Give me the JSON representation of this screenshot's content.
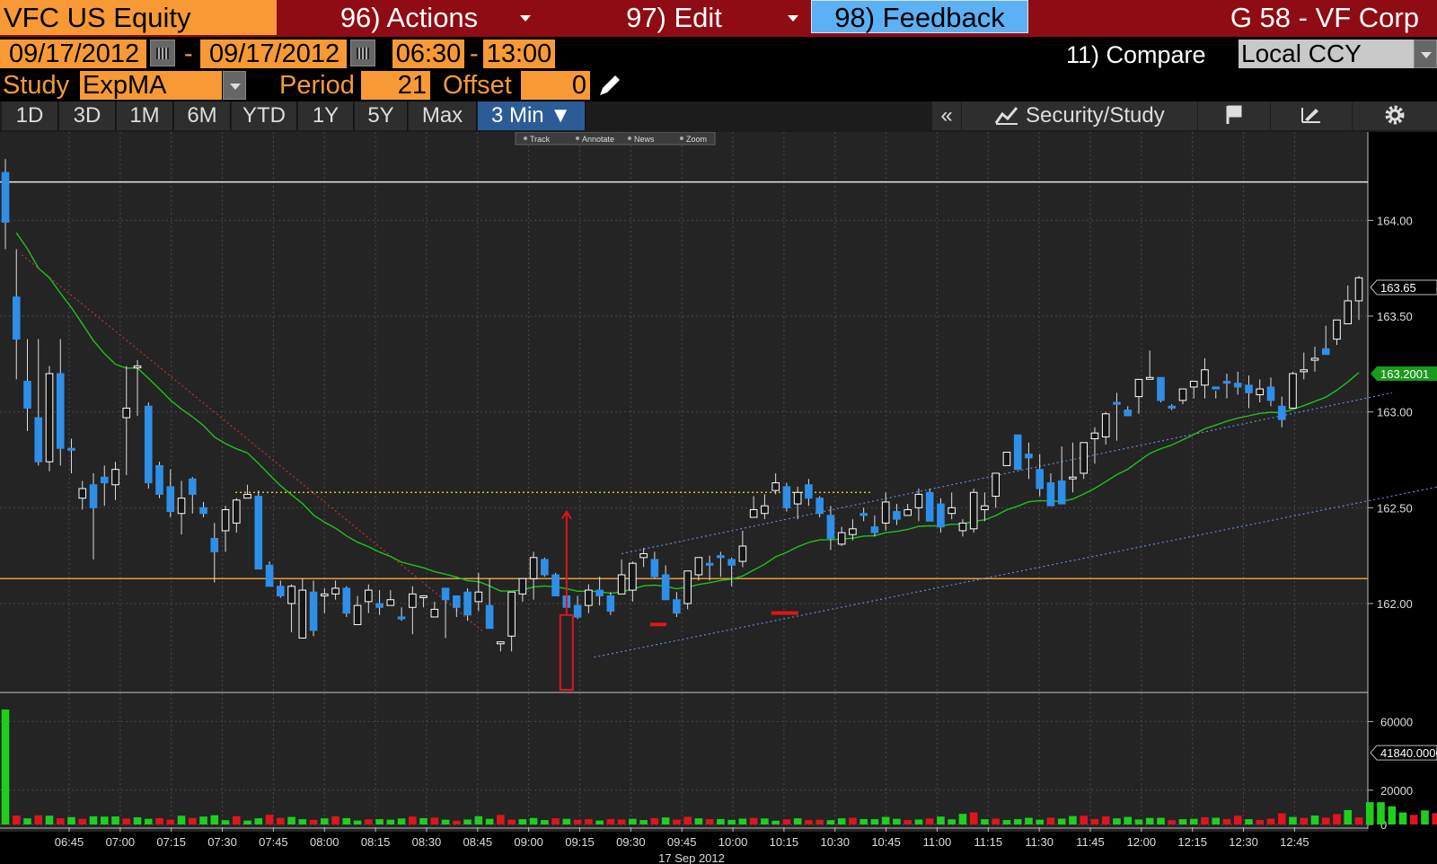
{
  "header": {
    "ticker": "VFC US Equity",
    "actions_label": "96) Actions",
    "edit_label": "97) Edit",
    "feedback_label": "98) Feedback",
    "right_title": "G 58 - VF Corp"
  },
  "controls": {
    "start_date": "09/17/2012",
    "date_sep": "-",
    "end_date": "09/17/2012",
    "start_time": "06:30",
    "time_sep": "-",
    "end_time": "13:00",
    "compare_label": "11) Compare",
    "currency": "Local CCY",
    "study_label": "Study",
    "study_value": "ExpMA",
    "period_label": "Period",
    "period_value": "21",
    "offset_label": "Offset",
    "offset_value": "0"
  },
  "toolbar": {
    "periods": [
      "1D",
      "3D",
      "1M",
      "6M",
      "YTD",
      "1Y",
      "5Y",
      "Max"
    ],
    "active_period": "3 Min ▼",
    "collapse": "«",
    "security_study": "Security/Study"
  },
  "mini_toolbar": [
    "Track",
    "Annotate",
    "News",
    "Zoom"
  ],
  "colors": {
    "up": "#ffffff",
    "down": "#2f8fe8",
    "ema": "#22c020",
    "vol_up": "#1ed01e",
    "vol_down": "#e0151c",
    "accent": "#f79a35"
  },
  "chart_data": {
    "type": "candlestick",
    "interval": "3 min",
    "date_label": "17 Sep 2012",
    "x_ticks": [
      "06:45",
      "07:00",
      "07:15",
      "07:30",
      "07:45",
      "08:00",
      "08:15",
      "08:30",
      "08:45",
      "09:00",
      "09:15",
      "09:30",
      "09:45",
      "10:00",
      "10:15",
      "10:30",
      "10:45",
      "11:00",
      "11:15",
      "11:30",
      "11:45",
      "12:00",
      "12:15",
      "12:30",
      "12:45"
    ],
    "price_axis": {
      "ticks": [
        "164.00",
        "163.50",
        "163.00",
        "162.50",
        "162.00"
      ],
      "range": [
        161.55,
        164.4
      ],
      "last_price": "163.65",
      "ema_value": "163.2001"
    },
    "volume_axis": {
      "ticks": [
        "60000",
        "20000",
        "0"
      ],
      "range": [
        0,
        67000
      ],
      "last_volume": "41840.0000"
    },
    "ema_study": {
      "name": "ExpMA",
      "period": 21
    },
    "reference_lines": {
      "white": 164.2,
      "orange": 162.13,
      "yellow_dotted": 162.58
    },
    "candles": [
      [
        164.25,
        164.32,
        163.85,
        163.99
      ],
      [
        163.6,
        163.85,
        163.17,
        163.38
      ],
      [
        163.16,
        163.38,
        162.9,
        163.02
      ],
      [
        162.97,
        163.38,
        162.72,
        162.74
      ],
      [
        162.74,
        163.24,
        162.69,
        163.2
      ],
      [
        163.2,
        163.38,
        162.72,
        162.81
      ],
      [
        162.81,
        162.86,
        162.68,
        162.8
      ],
      [
        162.55,
        162.64,
        162.49,
        162.6
      ],
      [
        162.62,
        162.68,
        162.23,
        162.5
      ],
      [
        162.66,
        162.72,
        162.51,
        162.63
      ],
      [
        162.62,
        162.74,
        162.54,
        162.7
      ],
      [
        162.97,
        163.24,
        162.67,
        163.02
      ],
      [
        163.24,
        163.27,
        162.98,
        163.24
      ],
      [
        163.03,
        163.05,
        162.6,
        162.63
      ],
      [
        162.72,
        162.74,
        162.55,
        162.57
      ],
      [
        162.61,
        162.7,
        162.45,
        162.48
      ],
      [
        162.47,
        162.64,
        162.36,
        162.55
      ],
      [
        162.65,
        162.66,
        162.47,
        162.57
      ],
      [
        162.5,
        162.53,
        162.45,
        162.47
      ],
      [
        162.34,
        162.42,
        162.11,
        162.27
      ],
      [
        162.38,
        162.51,
        162.27,
        162.49
      ],
      [
        162.42,
        162.55,
        162.37,
        162.54
      ],
      [
        162.55,
        162.62,
        162.55,
        162.57
      ],
      [
        162.56,
        162.59,
        162.33,
        162.18
      ],
      [
        162.2,
        162.22,
        162.1,
        162.09
      ],
      [
        162.09,
        162.12,
        162.03,
        162.04
      ],
      [
        162.0,
        162.1,
        161.85,
        162.09
      ],
      [
        161.82,
        162.13,
        161.84,
        162.07
      ],
      [
        162.06,
        162.12,
        161.83,
        161.86
      ],
      [
        162.04,
        162.08,
        161.95,
        162.05
      ],
      [
        162.05,
        162.12,
        162.02,
        162.08
      ],
      [
        162.08,
        162.09,
        161.93,
        161.95
      ],
      [
        161.89,
        162.04,
        161.95,
        161.99
      ],
      [
        162.01,
        162.1,
        161.95,
        162.07
      ],
      [
        162.0,
        162.07,
        161.94,
        161.98
      ],
      [
        161.99,
        162.07,
        161.99,
        162.02
      ],
      [
        161.93,
        161.98,
        161.91,
        161.92
      ],
      [
        161.98,
        162.09,
        161.84,
        162.05
      ],
      [
        162.04,
        162.04,
        161.98,
        162.04
      ],
      [
        161.93,
        162.01,
        161.95,
        161.97
      ],
      [
        162.08,
        162.06,
        161.82,
        162.02
      ],
      [
        162.04,
        162.04,
        161.93,
        161.98
      ],
      [
        162.06,
        162.08,
        161.91,
        161.94
      ],
      [
        162.01,
        162.16,
        161.96,
        162.06
      ],
      [
        161.99,
        162.13,
        161.89,
        161.87
      ],
      [
        161.79,
        161.8,
        161.75,
        161.8
      ],
      [
        161.83,
        162.02,
        161.75,
        162.06
      ],
      [
        162.05,
        162.08,
        162.01,
        162.13
      ],
      [
        162.13,
        162.27,
        162.02,
        162.24
      ],
      [
        162.23,
        162.24,
        162.14,
        162.15
      ],
      [
        162.15,
        162.16,
        162.04,
        162.04
      ],
      [
        162.04,
        162.11,
        161.94,
        161.98
      ],
      [
        161.99,
        162.04,
        161.92,
        161.93
      ],
      [
        161.99,
        162.1,
        161.95,
        162.07
      ],
      [
        162.07,
        162.14,
        161.99,
        162.04
      ],
      [
        162.04,
        162.06,
        161.94,
        161.96
      ],
      [
        162.05,
        162.23,
        162.05,
        162.15
      ],
      [
        162.07,
        162.22,
        162.01,
        162.21
      ],
      [
        162.24,
        162.29,
        162.19,
        162.26
      ],
      [
        162.23,
        162.27,
        162.13,
        162.14
      ],
      [
        162.15,
        162.2,
        162.09,
        162.02
      ],
      [
        162.02,
        162.06,
        161.93,
        161.95
      ],
      [
        162.0,
        162.17,
        161.97,
        162.17
      ],
      [
        162.15,
        162.24,
        162.12,
        162.24
      ],
      [
        162.21,
        162.25,
        162.12,
        162.2
      ],
      [
        162.25,
        162.27,
        162.14,
        162.24
      ],
      [
        162.23,
        162.24,
        162.09,
        162.2
      ],
      [
        162.22,
        162.38,
        162.19,
        162.3
      ],
      [
        162.45,
        162.56,
        162.46,
        162.49
      ],
      [
        162.47,
        162.57,
        162.44,
        162.51
      ],
      [
        162.59,
        162.68,
        162.57,
        162.63
      ],
      [
        162.61,
        162.63,
        162.48,
        162.5
      ],
      [
        162.52,
        162.61,
        162.44,
        162.58
      ],
      [
        162.62,
        162.65,
        162.51,
        162.55
      ],
      [
        162.55,
        162.56,
        162.45,
        162.47
      ],
      [
        162.46,
        162.51,
        162.28,
        162.34
      ],
      [
        162.31,
        162.4,
        162.3,
        162.37
      ],
      [
        162.36,
        162.44,
        162.33,
        162.39
      ],
      [
        162.47,
        162.5,
        162.43,
        162.46
      ],
      [
        162.4,
        162.46,
        162.35,
        162.37
      ],
      [
        162.42,
        162.58,
        162.38,
        162.53
      ],
      [
        162.48,
        162.52,
        162.41,
        162.44
      ],
      [
        162.46,
        162.52,
        162.46,
        162.49
      ],
      [
        162.5,
        162.6,
        162.43,
        162.57
      ],
      [
        162.58,
        162.6,
        162.43,
        162.43
      ],
      [
        162.52,
        162.55,
        162.37,
        162.4
      ],
      [
        162.47,
        162.58,
        162.44,
        162.5
      ],
      [
        162.38,
        162.44,
        162.35,
        162.42
      ],
      [
        162.39,
        162.6,
        162.37,
        162.58
      ],
      [
        162.49,
        162.58,
        162.43,
        162.51
      ],
      [
        162.56,
        162.68,
        162.5,
        162.68
      ],
      [
        162.72,
        162.78,
        162.72,
        162.79
      ],
      [
        162.88,
        162.88,
        162.72,
        162.7
      ],
      [
        162.78,
        162.84,
        162.65,
        162.76
      ],
      [
        162.7,
        162.78,
        162.56,
        162.6
      ],
      [
        162.63,
        162.68,
        162.55,
        162.51
      ],
      [
        162.64,
        162.82,
        162.52,
        162.52
      ],
      [
        162.66,
        162.84,
        162.58,
        162.66
      ],
      [
        162.68,
        162.84,
        162.65,
        162.84
      ],
      [
        162.86,
        162.92,
        162.73,
        162.89
      ],
      [
        162.87,
        163.0,
        162.83,
        162.99
      ],
      [
        163.05,
        163.1,
        162.85,
        163.04
      ],
      [
        163.01,
        163.03,
        162.99,
        162.98
      ],
      [
        163.08,
        163.14,
        162.99,
        163.17
      ],
      [
        163.18,
        163.32,
        163.18,
        163.18
      ],
      [
        163.18,
        163.17,
        163.05,
        163.06
      ],
      [
        163.03,
        163.04,
        163.01,
        163.02
      ],
      [
        163.06,
        163.12,
        163.04,
        163.12
      ],
      [
        163.13,
        163.14,
        163.07,
        163.16
      ],
      [
        163.14,
        163.28,
        163.07,
        163.22
      ],
      [
        163.13,
        163.11,
        163.07,
        163.12
      ],
      [
        163.16,
        163.2,
        163.07,
        163.15
      ],
      [
        163.15,
        163.21,
        163.09,
        163.13
      ],
      [
        163.14,
        163.19,
        163.02,
        163.1
      ],
      [
        163.09,
        163.17,
        163.05,
        163.12
      ],
      [
        163.13,
        163.18,
        163.03,
        163.06
      ],
      [
        163.03,
        163.08,
        162.92,
        162.96
      ],
      [
        163.02,
        163.21,
        163.02,
        163.2
      ],
      [
        163.21,
        163.31,
        163.17,
        163.22
      ],
      [
        163.27,
        163.34,
        163.21,
        163.28
      ],
      [
        163.33,
        163.45,
        163.3,
        163.3
      ],
      [
        163.38,
        163.45,
        163.35,
        163.48
      ],
      [
        163.46,
        163.66,
        163.46,
        163.58
      ],
      [
        163.58,
        163.71,
        163.48,
        163.7
      ]
    ],
    "volume": [
      [
        67000,
        "up"
      ],
      [
        5200,
        "down"
      ],
      [
        3600,
        "up"
      ],
      [
        5300,
        "down"
      ],
      [
        5100,
        "up"
      ],
      [
        3600,
        "down"
      ],
      [
        4300,
        "up"
      ],
      [
        3300,
        "down"
      ],
      [
        4800,
        "up"
      ],
      [
        4600,
        "up"
      ],
      [
        4700,
        "up"
      ],
      [
        3400,
        "down"
      ],
      [
        4200,
        "up"
      ],
      [
        3300,
        "up"
      ],
      [
        3700,
        "down"
      ],
      [
        2800,
        "down"
      ],
      [
        5100,
        "up"
      ],
      [
        3800,
        "down"
      ],
      [
        4600,
        "up"
      ],
      [
        5400,
        "up"
      ],
      [
        2500,
        "up"
      ],
      [
        4800,
        "down"
      ],
      [
        2300,
        "up"
      ],
      [
        3600,
        "up"
      ],
      [
        5700,
        "down"
      ],
      [
        3800,
        "down"
      ],
      [
        4400,
        "up"
      ],
      [
        3100,
        "up"
      ],
      [
        2700,
        "down"
      ],
      [
        3600,
        "up"
      ],
      [
        4800,
        "down"
      ],
      [
        3700,
        "up"
      ],
      [
        2300,
        "up"
      ],
      [
        3000,
        "down"
      ],
      [
        3100,
        "up"
      ],
      [
        2800,
        "up"
      ],
      [
        3500,
        "up"
      ],
      [
        4600,
        "down"
      ],
      [
        3700,
        "up"
      ],
      [
        4000,
        "down"
      ],
      [
        2800,
        "up"
      ],
      [
        2200,
        "down"
      ],
      [
        2900,
        "up"
      ],
      [
        4800,
        "up"
      ],
      [
        3300,
        "up"
      ],
      [
        5600,
        "down"
      ],
      [
        2800,
        "down"
      ],
      [
        3100,
        "up"
      ],
      [
        3800,
        "up"
      ],
      [
        2600,
        "up"
      ],
      [
        3600,
        "down"
      ],
      [
        3300,
        "up"
      ],
      [
        2700,
        "down"
      ],
      [
        3100,
        "down"
      ],
      [
        2300,
        "up"
      ],
      [
        3200,
        "down"
      ],
      [
        2900,
        "down"
      ],
      [
        3300,
        "up"
      ],
      [
        2600,
        "up"
      ],
      [
        3700,
        "down"
      ],
      [
        4100,
        "up"
      ],
      [
        2800,
        "down"
      ],
      [
        4500,
        "down"
      ],
      [
        3600,
        "up"
      ],
      [
        3100,
        "down"
      ],
      [
        3200,
        "up"
      ],
      [
        2700,
        "up"
      ],
      [
        3400,
        "up"
      ],
      [
        3800,
        "down"
      ],
      [
        3500,
        "up"
      ],
      [
        2200,
        "up"
      ],
      [
        3000,
        "down"
      ],
      [
        3600,
        "up"
      ],
      [
        2500,
        "down"
      ],
      [
        2700,
        "down"
      ],
      [
        2500,
        "up"
      ],
      [
        3600,
        "up"
      ],
      [
        3900,
        "down"
      ],
      [
        3200,
        "up"
      ],
      [
        3100,
        "up"
      ],
      [
        4400,
        "up"
      ],
      [
        3300,
        "up"
      ],
      [
        2600,
        "down"
      ],
      [
        2900,
        "up"
      ],
      [
        3500,
        "down"
      ],
      [
        4600,
        "up"
      ],
      [
        3000,
        "up"
      ],
      [
        6200,
        "up"
      ],
      [
        7000,
        "down"
      ],
      [
        3100,
        "up"
      ],
      [
        3400,
        "down"
      ],
      [
        2600,
        "up"
      ],
      [
        3100,
        "up"
      ],
      [
        3900,
        "up"
      ],
      [
        2800,
        "up"
      ],
      [
        4000,
        "down"
      ],
      [
        3400,
        "up"
      ],
      [
        4900,
        "up"
      ],
      [
        5100,
        "down"
      ],
      [
        3200,
        "down"
      ],
      [
        4700,
        "down"
      ],
      [
        3600,
        "up"
      ],
      [
        4400,
        "up"
      ],
      [
        2900,
        "up"
      ],
      [
        3800,
        "up"
      ],
      [
        3900,
        "up"
      ],
      [
        2500,
        "down"
      ],
      [
        3100,
        "up"
      ],
      [
        3300,
        "up"
      ],
      [
        4200,
        "down"
      ],
      [
        3900,
        "up"
      ],
      [
        3200,
        "down"
      ],
      [
        5100,
        "down"
      ],
      [
        3100,
        "up"
      ],
      [
        2600,
        "down"
      ],
      [
        3400,
        "down"
      ],
      [
        6500,
        "down"
      ],
      [
        4400,
        "up"
      ],
      [
        3800,
        "down"
      ],
      [
        5200,
        "up"
      ],
      [
        4000,
        "down"
      ],
      [
        6100,
        "down"
      ],
      [
        8400,
        "up"
      ],
      [
        4100,
        "down"
      ],
      [
        13000,
        "up"
      ],
      [
        13000,
        "up"
      ],
      [
        10600,
        "up"
      ],
      [
        7000,
        "up"
      ],
      [
        5600,
        "down"
      ],
      [
        8200,
        "up"
      ],
      [
        6600,
        "down"
      ],
      [
        3500,
        "down"
      ],
      [
        3800,
        "up"
      ],
      [
        2500,
        "down"
      ],
      [
        4900,
        "up"
      ],
      [
        3800,
        "down"
      ],
      [
        4300,
        "down"
      ],
      [
        3300,
        "up"
      ],
      [
        3600,
        "up"
      ],
      [
        3800,
        "down"
      ],
      [
        4500,
        "up"
      ],
      [
        2800,
        "down"
      ],
      [
        3100,
        "up"
      ],
      [
        3600,
        "down"
      ],
      [
        6800,
        "down"
      ],
      [
        6400,
        "up"
      ],
      [
        15200,
        "up"
      ],
      [
        20200,
        "up"
      ],
      [
        41840,
        "up"
      ]
    ]
  }
}
